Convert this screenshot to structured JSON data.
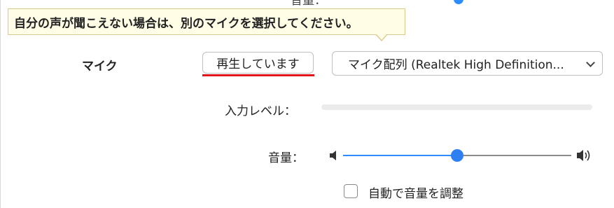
{
  "tooltip": {
    "text": "自分の声が聞こえない場合は、別のマイクを選択してください。"
  },
  "microphone": {
    "label": "マイク",
    "test_button_label": "再生しています",
    "selected_device": "マイク配列 (Realtek High Definition..."
  },
  "input_level": {
    "label": "入力レベル：",
    "value": 0
  },
  "volume": {
    "label": "音量：",
    "value": 0.5
  },
  "auto_adjust": {
    "label": "自動で音量を調整",
    "checked": false
  },
  "colors": {
    "accent": "#2d8cff",
    "highlight_underline": "#e3141b",
    "tooltip_background": "#fffde6"
  }
}
